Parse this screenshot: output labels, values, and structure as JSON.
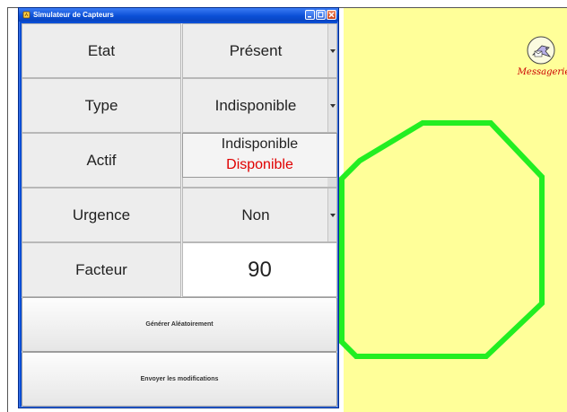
{
  "window": {
    "title": "Simulateur de Capteurs"
  },
  "fields": {
    "etat": {
      "label": "Etat",
      "value": "Présent"
    },
    "type": {
      "label": "Type",
      "value": "Indisponible"
    },
    "actif": {
      "label": "Actif",
      "options": [
        "Indisponible",
        "Disponible"
      ],
      "selected": "Disponible"
    },
    "urgence": {
      "label": "Urgence",
      "value": "Non"
    },
    "facteur": {
      "label": "Facteur",
      "value": "90"
    }
  },
  "buttons": {
    "generate": "Générer Aléatoirement",
    "send": "Envoyer les modifications"
  },
  "background": {
    "messagerie_label": "Messagerie",
    "colors": {
      "canvas": "#ffff99",
      "octagon_stroke": "#22ee22",
      "selected_option": "#e00000",
      "title_bar": "#0a4fd6"
    }
  },
  "icons": [
    "app-icon",
    "minimize-icon",
    "maximize-icon",
    "close-icon",
    "chevron-down-icon",
    "messagerie-bird-icon"
  ]
}
